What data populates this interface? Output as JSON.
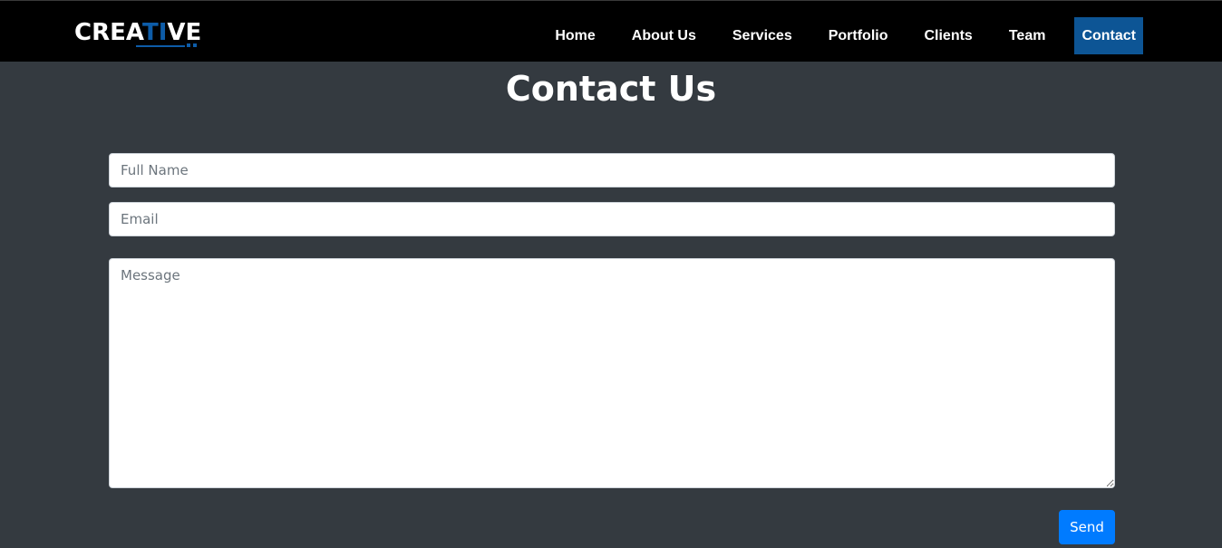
{
  "navbar": {
    "logo": {
      "part1": "CREA",
      "accent": "TI",
      "part2": "VE"
    },
    "items": [
      {
        "label": "Home"
      },
      {
        "label": "About Us"
      },
      {
        "label": "Services"
      },
      {
        "label": "Portfolio"
      },
      {
        "label": "Clients"
      },
      {
        "label": "Team"
      },
      {
        "label": "Contact",
        "active": true
      }
    ]
  },
  "page": {
    "title": "Contact Us"
  },
  "form": {
    "full_name": {
      "placeholder": "Full Name",
      "value": ""
    },
    "email": {
      "placeholder": "Email",
      "value": ""
    },
    "message": {
      "placeholder": "Message",
      "value": ""
    },
    "send_label": "Send"
  },
  "colors": {
    "background": "#343a40",
    "navbar": "#000000",
    "accent": "#0d5595",
    "button": "#007bff"
  }
}
